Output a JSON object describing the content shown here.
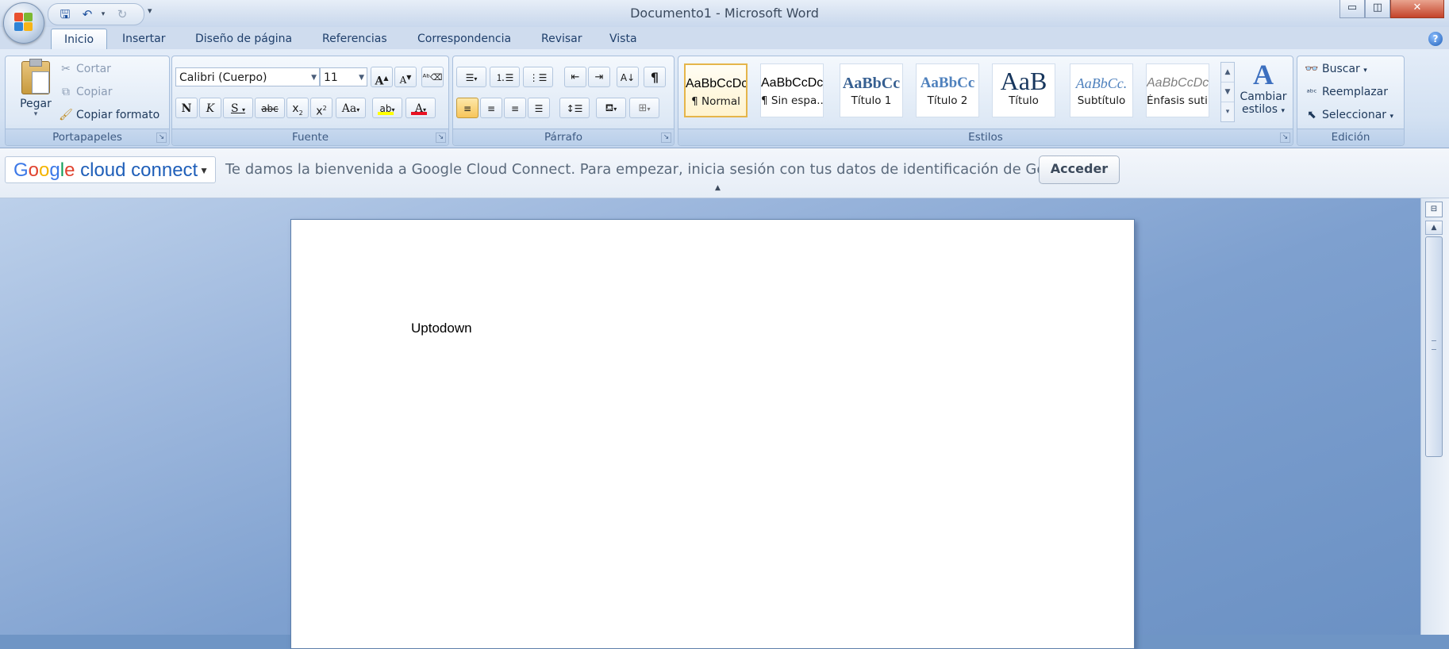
{
  "window": {
    "title": "Documento1 - Microsoft Word",
    "controls": {
      "minimize": "▭",
      "maximize": "◫",
      "close": "✕"
    }
  },
  "qat": {
    "icons": [
      "save-icon",
      "undo-icon",
      "redo-icon",
      "customize-icon"
    ]
  },
  "tabs": [
    {
      "label": "Inicio",
      "active": true
    },
    {
      "label": "Insertar"
    },
    {
      "label": "Diseño de página"
    },
    {
      "label": "Referencias"
    },
    {
      "label": "Correspondencia"
    },
    {
      "label": "Revisar"
    },
    {
      "label": "Vista"
    }
  ],
  "clipboard": {
    "group_label": "Portapapeles",
    "paste": "Pegar",
    "cut": "Cortar",
    "copy": "Copiar",
    "format_painter": "Copiar formato"
  },
  "font": {
    "group_label": "Fuente",
    "font_name": "Calibri (Cuerpo)",
    "font_size": "11",
    "grow": "A",
    "shrink": "A",
    "bold": "N",
    "italic": "K",
    "underline": "S",
    "strike": "abc",
    "subscript": "x",
    "superscript": "x",
    "change_case": "Aa",
    "font_color": "A",
    "highlight_color": "#ffff00",
    "font_color_value": "#e81123"
  },
  "paragraph": {
    "group_label": "Párrafo",
    "pilcrow": "¶"
  },
  "styles": {
    "group_label": "Estilos",
    "items": [
      {
        "sample": "AaBbCcDc",
        "name": "¶ Normal"
      },
      {
        "sample": "AaBbCcDc",
        "name": "¶ Sin espa..."
      },
      {
        "sample": "AaBbCc",
        "name": "Título 1"
      },
      {
        "sample": "AaBbCc",
        "name": "Título 2"
      },
      {
        "sample": "AaB",
        "name": "Título"
      },
      {
        "sample": "AaBbCc.",
        "name": "Subtítulo"
      },
      {
        "sample": "AaBbCcDc",
        "name": "Énfasis sutil"
      }
    ],
    "change_styles_line1": "Cambiar",
    "change_styles_line2": "estilos"
  },
  "editing": {
    "group_label": "Edición",
    "find": "Buscar",
    "replace": "Reemplazar",
    "select": "Seleccionar"
  },
  "google_bar": {
    "logo_google": "Google",
    "logo_rest": " cloud connect",
    "message": "Te damos la bienvenida a Google Cloud Connect. Para empezar, inicia sesión con tus datos de identificación de Google:",
    "button": "Acceder"
  },
  "document": {
    "text": "Uptodown"
  }
}
